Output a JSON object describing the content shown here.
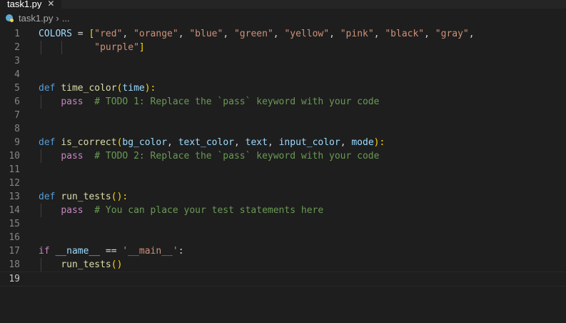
{
  "tab": {
    "label": "task1.py",
    "close": "✕",
    "accent": "#0e639c"
  },
  "breadcrumb": {
    "file": "task1.py",
    "sep": "›",
    "rest": "..."
  },
  "editor": {
    "current_line": 19,
    "lines": [
      {
        "n": "1",
        "tokens": [
          [
            "var",
            "COLORS"
          ],
          [
            "plain",
            " = "
          ],
          [
            "bracket",
            "["
          ],
          [
            "str",
            "\"red\""
          ],
          [
            "plain",
            ", "
          ],
          [
            "str",
            "\"orange\""
          ],
          [
            "plain",
            ", "
          ],
          [
            "str",
            "\"blue\""
          ],
          [
            "plain",
            ", "
          ],
          [
            "str",
            "\"green\""
          ],
          [
            "plain",
            ", "
          ],
          [
            "str",
            "\"yellow\""
          ],
          [
            "plain",
            ", "
          ],
          [
            "str",
            "\"pink\""
          ],
          [
            "plain",
            ", "
          ],
          [
            "str",
            "\"black\""
          ],
          [
            "plain",
            ", "
          ],
          [
            "str",
            "\"gray\""
          ],
          [
            "plain",
            ","
          ]
        ]
      },
      {
        "n": "2",
        "tokens": [
          [
            "plain",
            "          "
          ],
          [
            "str",
            "\"purple\""
          ],
          [
            "bracket",
            "]"
          ]
        ]
      },
      {
        "n": "3",
        "tokens": []
      },
      {
        "n": "4",
        "tokens": []
      },
      {
        "n": "5",
        "tokens": [
          [
            "kw",
            "def "
          ],
          [
            "fn",
            "time_color"
          ],
          [
            "bracket",
            "("
          ],
          [
            "var",
            "time"
          ],
          [
            "bracket",
            "):"
          ]
        ]
      },
      {
        "n": "6",
        "tokens": [
          [
            "plain",
            "    "
          ],
          [
            "ctrl",
            "pass"
          ],
          [
            "com",
            "  # TODO 1: Replace the `pass` keyword with your code"
          ]
        ]
      },
      {
        "n": "7",
        "tokens": []
      },
      {
        "n": "8",
        "tokens": []
      },
      {
        "n": "9",
        "tokens": [
          [
            "kw",
            "def "
          ],
          [
            "fn",
            "is_correct"
          ],
          [
            "bracket",
            "("
          ],
          [
            "var",
            "bg_color"
          ],
          [
            "plain",
            ", "
          ],
          [
            "var",
            "text_color"
          ],
          [
            "plain",
            ", "
          ],
          [
            "var",
            "text"
          ],
          [
            "plain",
            ", "
          ],
          [
            "var",
            "input_color"
          ],
          [
            "plain",
            ", "
          ],
          [
            "var",
            "mode"
          ],
          [
            "bracket",
            "):"
          ]
        ]
      },
      {
        "n": "10",
        "tokens": [
          [
            "plain",
            "    "
          ],
          [
            "ctrl",
            "pass"
          ],
          [
            "com",
            "  # TODO 2: Replace the `pass` keyword with your code"
          ]
        ]
      },
      {
        "n": "11",
        "tokens": []
      },
      {
        "n": "12",
        "tokens": []
      },
      {
        "n": "13",
        "tokens": [
          [
            "kw",
            "def "
          ],
          [
            "fn",
            "run_tests"
          ],
          [
            "bracket",
            "():"
          ]
        ]
      },
      {
        "n": "14",
        "tokens": [
          [
            "plain",
            "    "
          ],
          [
            "ctrl",
            "pass"
          ],
          [
            "com",
            "  # You can place your test statements here"
          ]
        ]
      },
      {
        "n": "15",
        "tokens": []
      },
      {
        "n": "16",
        "tokens": []
      },
      {
        "n": "17",
        "tokens": [
          [
            "ctrl",
            "if "
          ],
          [
            "var",
            "__name__"
          ],
          [
            "plain",
            " == "
          ],
          [
            "str",
            "'__main__'"
          ],
          [
            "plain",
            ":"
          ]
        ]
      },
      {
        "n": "18",
        "tokens": [
          [
            "plain",
            "    "
          ],
          [
            "fn",
            "run_tests"
          ],
          [
            "bracket",
            "()"
          ]
        ]
      },
      {
        "n": "19",
        "tokens": []
      }
    ]
  }
}
